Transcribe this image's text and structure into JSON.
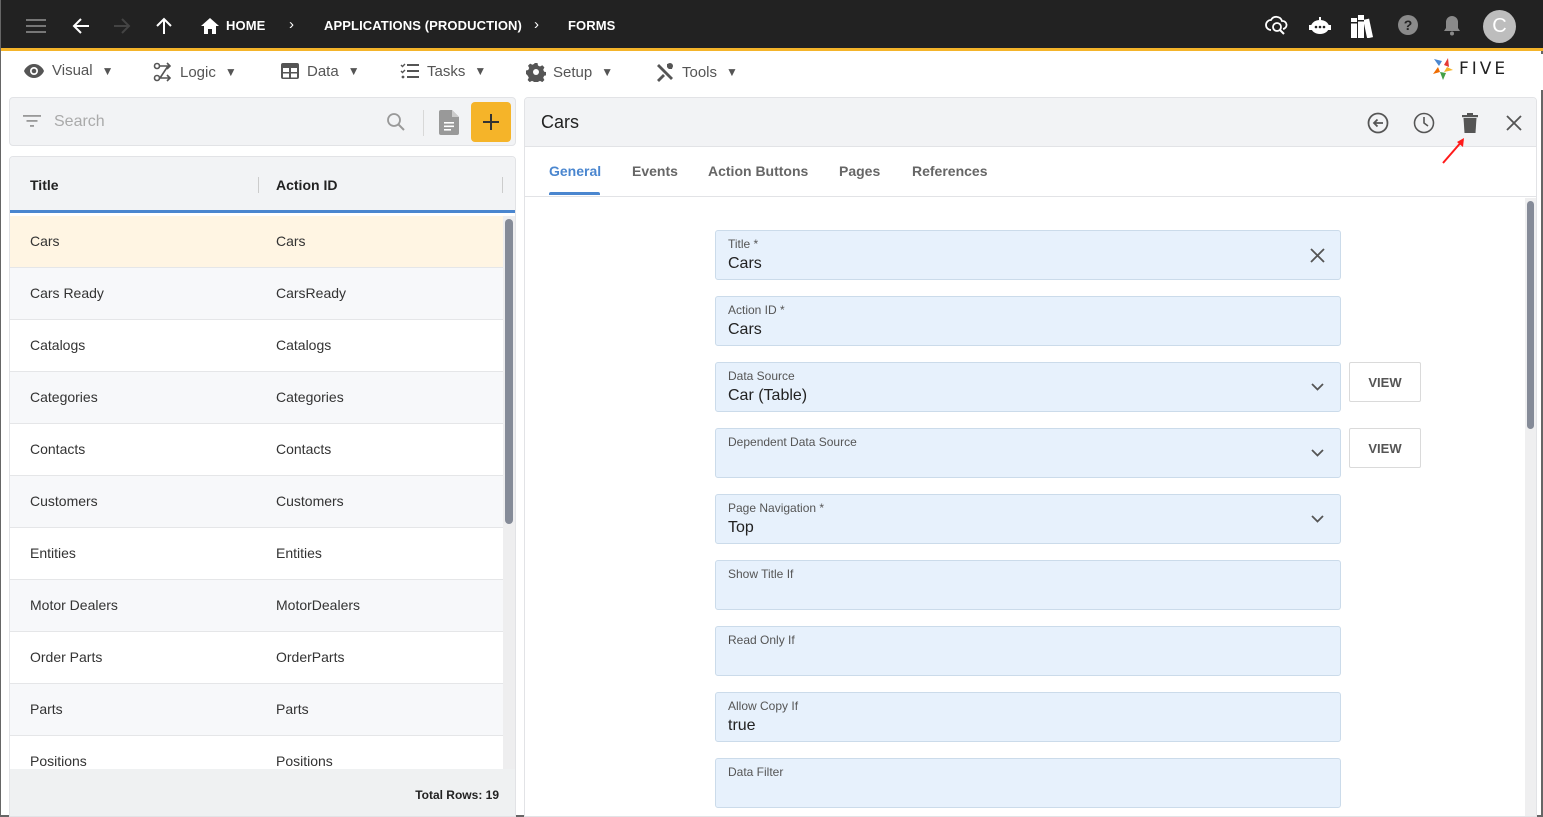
{
  "topbar": {
    "breadcrumbs": [
      "HOME",
      "APPLICATIONS (PRODUCTION)",
      "FORMS"
    ],
    "icons": [
      "menu-icon",
      "back-arrow-icon",
      "forward-arrow-icon",
      "up-arrow-icon",
      "home-icon",
      "cloud-search-icon",
      "chat-bot-icon",
      "library-books-icon",
      "help-icon",
      "notifications-bell-icon"
    ],
    "avatar_initial": "C"
  },
  "menubar": {
    "items": [
      {
        "label": "Visual",
        "icon": "eye-icon"
      },
      {
        "label": "Logic",
        "icon": "logic-flow-icon"
      },
      {
        "label": "Data",
        "icon": "table-grid-icon"
      },
      {
        "label": "Tasks",
        "icon": "checklist-icon"
      },
      {
        "label": "Setup",
        "icon": "gear-icon"
      },
      {
        "label": "Tools",
        "icon": "tools-icon"
      }
    ],
    "caret": "▼",
    "logo_text": "FIVE"
  },
  "search": {
    "placeholder": "Search",
    "value": ""
  },
  "list": {
    "columns": [
      "Title",
      "Action ID"
    ],
    "rows": [
      {
        "title": "Cars",
        "action_id": "Cars",
        "selected": true
      },
      {
        "title": "Cars Ready",
        "action_id": "CarsReady"
      },
      {
        "title": "Catalogs",
        "action_id": "Catalogs"
      },
      {
        "title": "Categories",
        "action_id": "Categories"
      },
      {
        "title": "Contacts",
        "action_id": "Contacts"
      },
      {
        "title": "Customers",
        "action_id": "Customers"
      },
      {
        "title": "Entities",
        "action_id": "Entities"
      },
      {
        "title": "Motor Dealers",
        "action_id": "MotorDealers"
      },
      {
        "title": "Order Parts",
        "action_id": "OrderParts"
      },
      {
        "title": "Parts",
        "action_id": "Parts"
      },
      {
        "title": "Positions",
        "action_id": "Positions"
      }
    ],
    "total_rows_label": "Total Rows: 19"
  },
  "detail": {
    "title": "Cars",
    "tabs": [
      "General",
      "Events",
      "Action Buttons",
      "Pages",
      "References"
    ],
    "active_tab": "General",
    "fields": [
      {
        "label": "Title *",
        "value": "Cars",
        "type": "text-clearable"
      },
      {
        "label": "Action ID *",
        "value": "Cars",
        "type": "text"
      },
      {
        "label": "Data Source",
        "value": "Car (Table)",
        "type": "select",
        "button": "VIEW"
      },
      {
        "label": "Dependent Data Source",
        "value": "",
        "type": "select",
        "button": "VIEW"
      },
      {
        "label": "Page Navigation *",
        "value": "Top",
        "type": "select"
      },
      {
        "label": "Show Title If",
        "value": "",
        "type": "text"
      },
      {
        "label": "Read Only If",
        "value": "",
        "type": "text"
      },
      {
        "label": "Allow Copy If",
        "value": "true",
        "type": "text"
      },
      {
        "label": "Data Filter",
        "value": "",
        "type": "text"
      }
    ]
  },
  "colors": {
    "accent": "#f4b42a",
    "primary": "#4a86cf",
    "topbar": "#222222",
    "field_bg": "#e7f1fc",
    "selected_row": "#fff5e3",
    "annotation_arrow": "#ff1a1a"
  }
}
